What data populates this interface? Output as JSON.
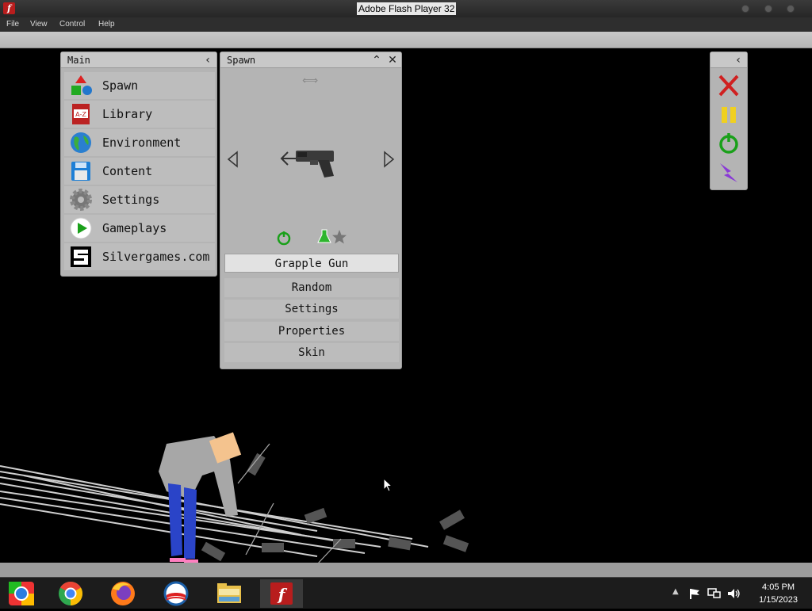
{
  "window": {
    "title": "Adobe Flash Player 32"
  },
  "menu": {
    "file": "File",
    "view": "View",
    "control": "Control",
    "help": "Help"
  },
  "main_panel": {
    "title": "Main",
    "items": [
      {
        "label": "Spawn",
        "icon": "spawn-shapes-icon"
      },
      {
        "label": "Library",
        "icon": "library-book-icon"
      },
      {
        "label": "Environment",
        "icon": "globe-icon"
      },
      {
        "label": "Content",
        "icon": "floppy-disk-icon"
      },
      {
        "label": "Settings",
        "icon": "gear-icon"
      },
      {
        "label": "Gameplays",
        "icon": "play-icon"
      },
      {
        "label": "Silvergames.com",
        "icon": "silvergames-logo-icon"
      }
    ]
  },
  "spawn_panel": {
    "title": "Spawn",
    "item_name": "Grapple Gun",
    "buttons": [
      "Random",
      "Settings",
      "Properties",
      "Skin"
    ]
  },
  "taskbar": {
    "time": "4:05 PM",
    "date": "1/15/2023",
    "apps": [
      "chrome-old-icon",
      "chrome-icon",
      "firefox-icon",
      "obama-logo-icon",
      "file-explorer-icon",
      "flash-player-icon"
    ]
  },
  "colors": {
    "close_red": "#d02020",
    "pause_yellow": "#f0d020",
    "reset_green": "#1aa01a",
    "power_purple": "#8a3ad6"
  }
}
